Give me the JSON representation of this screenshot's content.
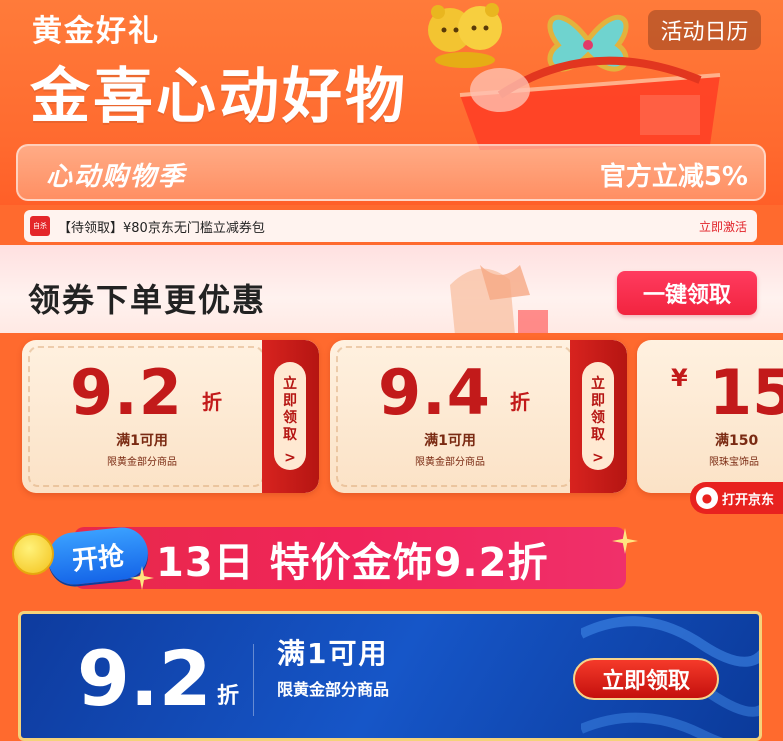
{
  "header": {
    "tag": "黄金好礼",
    "title": "金喜心动好物",
    "calendar_btn": "活动日历",
    "season": "心动购物季",
    "discount": "官方立减5%"
  },
  "strip": {
    "icon_text": "自杀",
    "text": "【待领取】¥80京东无门槛立减券包",
    "link": "立即激活"
  },
  "coupons": {
    "title": "领券下单更优惠",
    "one_click": "一键领取",
    "cards": [
      {
        "value": "9.2",
        "unit": "折",
        "condition": "满1可用",
        "scope": "限黄金部分商品",
        "action": [
          "立",
          "即",
          "领",
          "取"
        ],
        "arrow": ">"
      },
      {
        "value": "9.4",
        "unit": "折",
        "condition": "满1可用",
        "scope": "限黄金部分商品",
        "action": [
          "立",
          "即",
          "领",
          "取"
        ],
        "arrow": ">"
      }
    ],
    "card3": {
      "currency": "¥",
      "value": "15",
      "condition": "满150",
      "scope": "限珠宝饰品"
    }
  },
  "open_jd": "打开京东",
  "promo": {
    "badge": "开抢",
    "text": "13日 特价金饰9.2折"
  },
  "big_coupon": {
    "value": "9.2",
    "unit": "折",
    "condition": "满1可用",
    "scope": "限黄金部分商品",
    "button": "立即领取"
  },
  "colors": {
    "brand_orange": "#ff6a2e",
    "coupon_red": "#c21a1a",
    "banner_blue": "#1656c8"
  }
}
